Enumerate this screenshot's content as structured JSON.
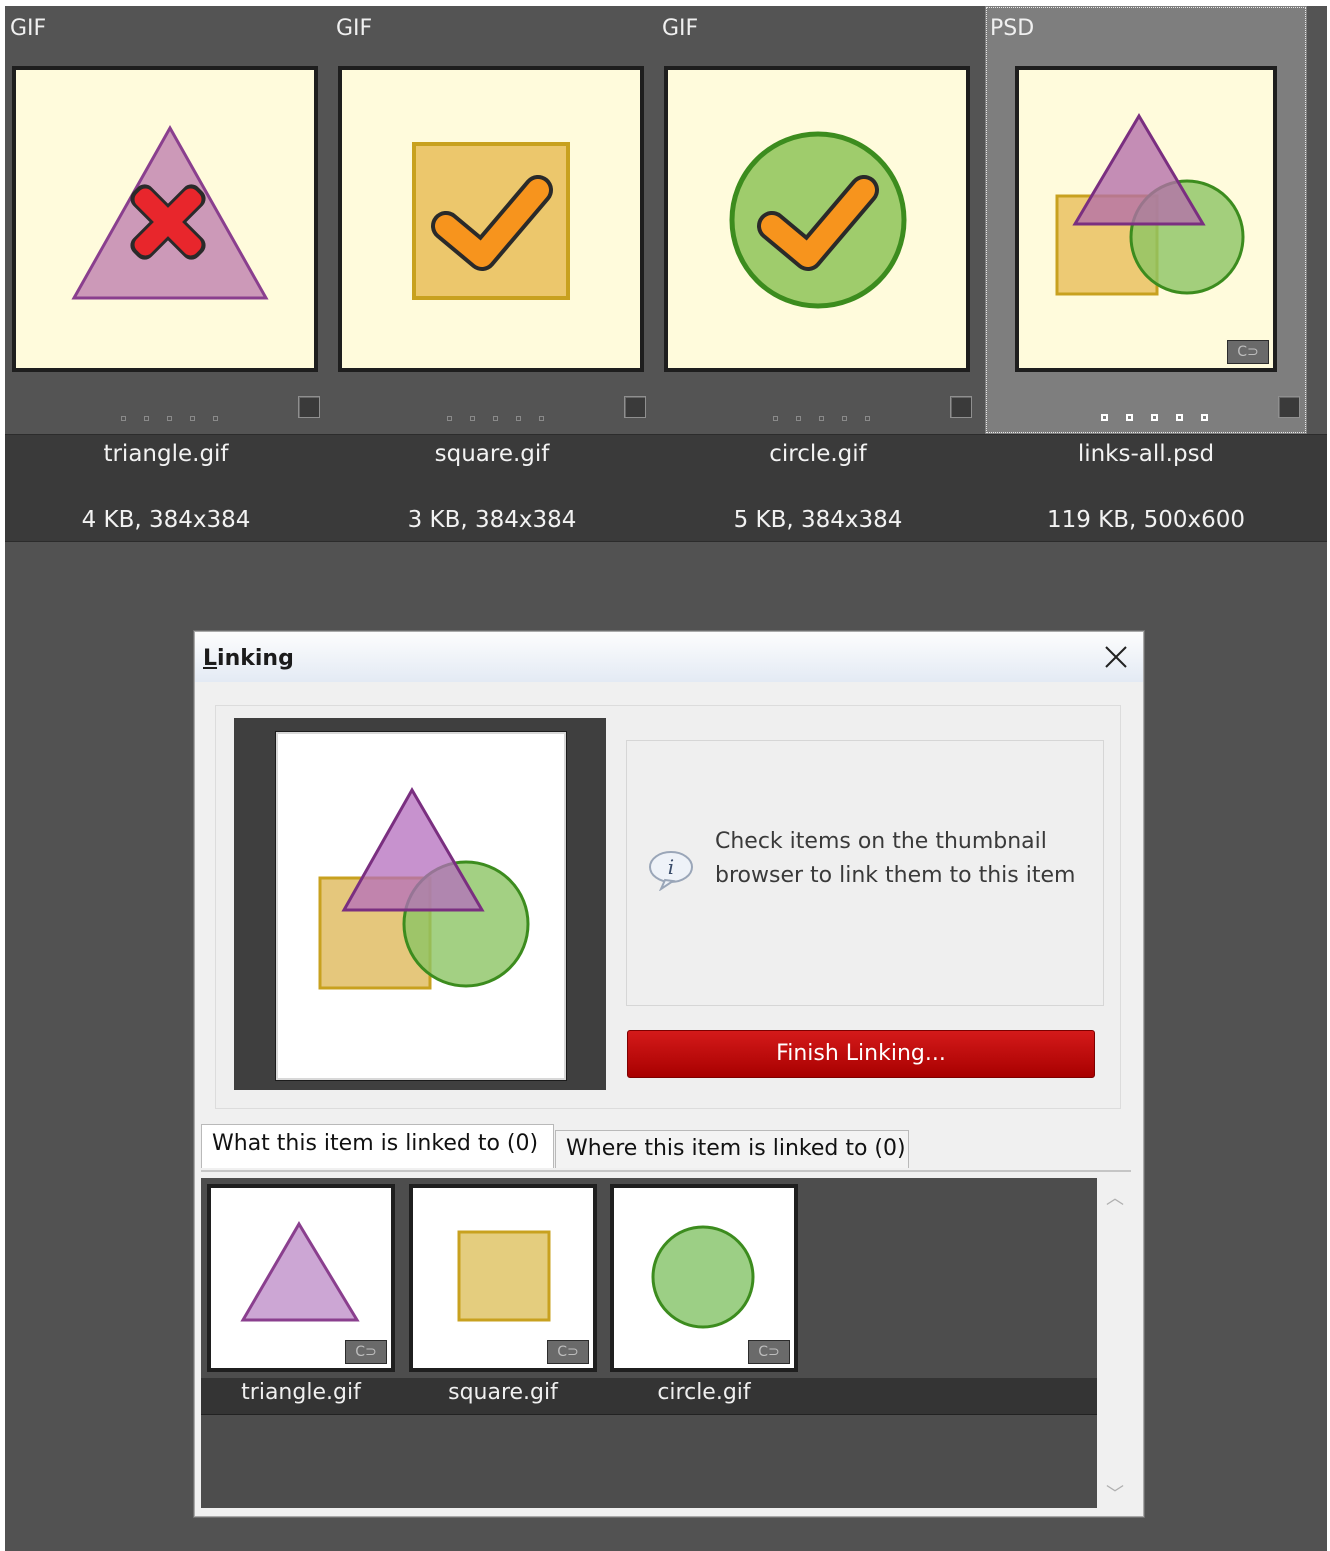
{
  "browser": {
    "items": [
      {
        "type": "GIF",
        "name": "triangle.gif",
        "meta": "4 KB, 384x384",
        "selected": false
      },
      {
        "type": "GIF",
        "name": "square.gif",
        "meta": "3 KB, 384x384",
        "selected": false
      },
      {
        "type": "GIF",
        "name": "circle.gif",
        "meta": "5 KB, 384x384",
        "selected": false
      },
      {
        "type": "PSD",
        "name": "links-all.psd",
        "meta": "119 KB, 500x600",
        "selected": true
      }
    ],
    "link_badge": "C⊃"
  },
  "dialog": {
    "title_underlined": "L",
    "title_rest": "inking",
    "close_symbol": "✕",
    "hint_text": "Check items on the thumbnail browser to link them to this item",
    "finish_button": "Finish Linking...",
    "tabs": [
      {
        "label": "What this item is linked to (0)",
        "active": true
      },
      {
        "label": "Where this item is linked to (0)",
        "active": false
      }
    ],
    "linked_items": [
      {
        "name": "triangle.gif",
        "shape": "triangle"
      },
      {
        "name": "square.gif",
        "shape": "square"
      },
      {
        "name": "circle.gif",
        "shape": "circle"
      }
    ],
    "scroll_up": "︿",
    "scroll_down": "﹀"
  },
  "colors": {
    "triangle_fill": "#cc99c4",
    "triangle_stroke": "#8a3f8e",
    "square_fill": "#e9c76f",
    "square_stroke": "#c8a11f",
    "circle_fill": "#9fcc7d",
    "circle_stroke": "#3c8c1e",
    "check_orange": "#f7941d",
    "x_red": "#e8262c",
    "finish_red": "#b80000"
  }
}
